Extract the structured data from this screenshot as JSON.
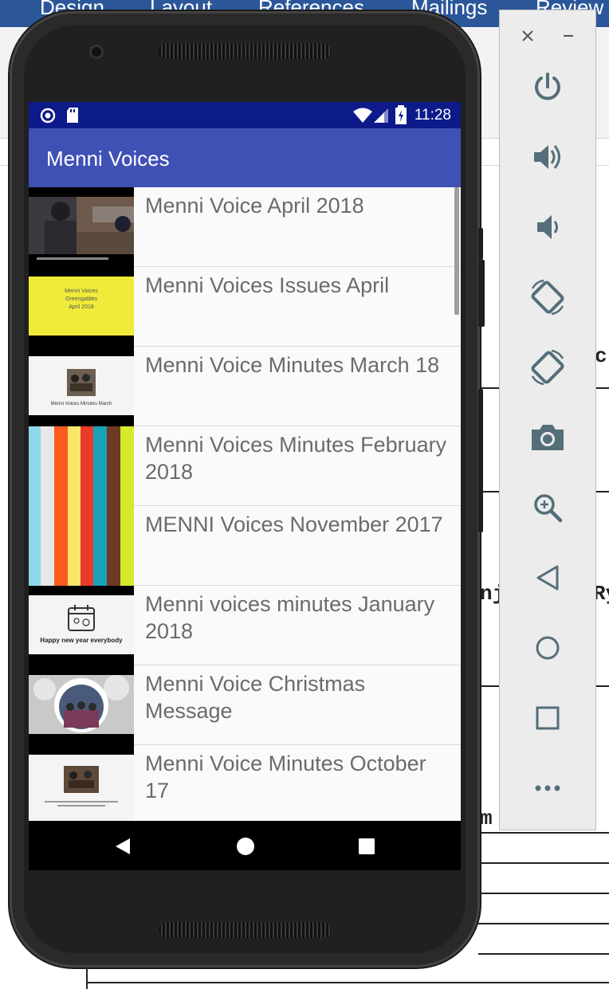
{
  "background_window": {
    "ribbon_tabs": [
      "Design",
      "Layout",
      "References",
      "Mailings",
      "Review"
    ],
    "doc_text_fragments": [
      "c",
      "nj",
      "Ry",
      "m"
    ]
  },
  "phone": {
    "status_bar": {
      "time": "11:28"
    },
    "app": {
      "title": "Menni Voices",
      "items": [
        {
          "title": "Menni Voice April 2018",
          "thumbnail": "photo-people"
        },
        {
          "title": "Menni Voices Issues April",
          "thumbnail": "yellow-slide",
          "thumb_text": [
            "Menni Voices",
            "Greengables",
            "April 2018"
          ]
        },
        {
          "title": "Menni Voice Minutes March 18",
          "thumbnail": "meeting-slide",
          "thumb_caption": "Menni Voices Minutes March"
        },
        {
          "title": "Menni Voices Minutes February 2018",
          "thumbnail": "color-stripes"
        },
        {
          "title": "MENNI Voices November 2017",
          "thumbnail": "color-stripes"
        },
        {
          "title": "Menni voices minutes January 2018",
          "thumbnail": "calendar-slide",
          "thumb_caption": "Happy new year everybody"
        },
        {
          "title": "Menni Voice Christmas Message",
          "thumbnail": "christmas-photo"
        },
        {
          "title": "Menni Voice Minutes October 17",
          "thumbnail": "meeting-slide-2"
        }
      ]
    },
    "nav_bar": [
      "back-icon",
      "home-icon",
      "recents-icon"
    ]
  },
  "emulator_panel": {
    "buttons": [
      "close-icon",
      "minimize-icon",
      "power-icon",
      "volume-up-icon",
      "volume-down-icon",
      "rotate-left-icon",
      "rotate-right-icon",
      "camera-icon",
      "zoom-icon",
      "back-icon",
      "home-icon",
      "overview-icon",
      "more-icon"
    ]
  },
  "colors": {
    "status_bar": "#0d1a8a",
    "app_bar": "#3f51b5",
    "list_text": "#6b6b6b",
    "emulator_icon": "#546e7a"
  }
}
